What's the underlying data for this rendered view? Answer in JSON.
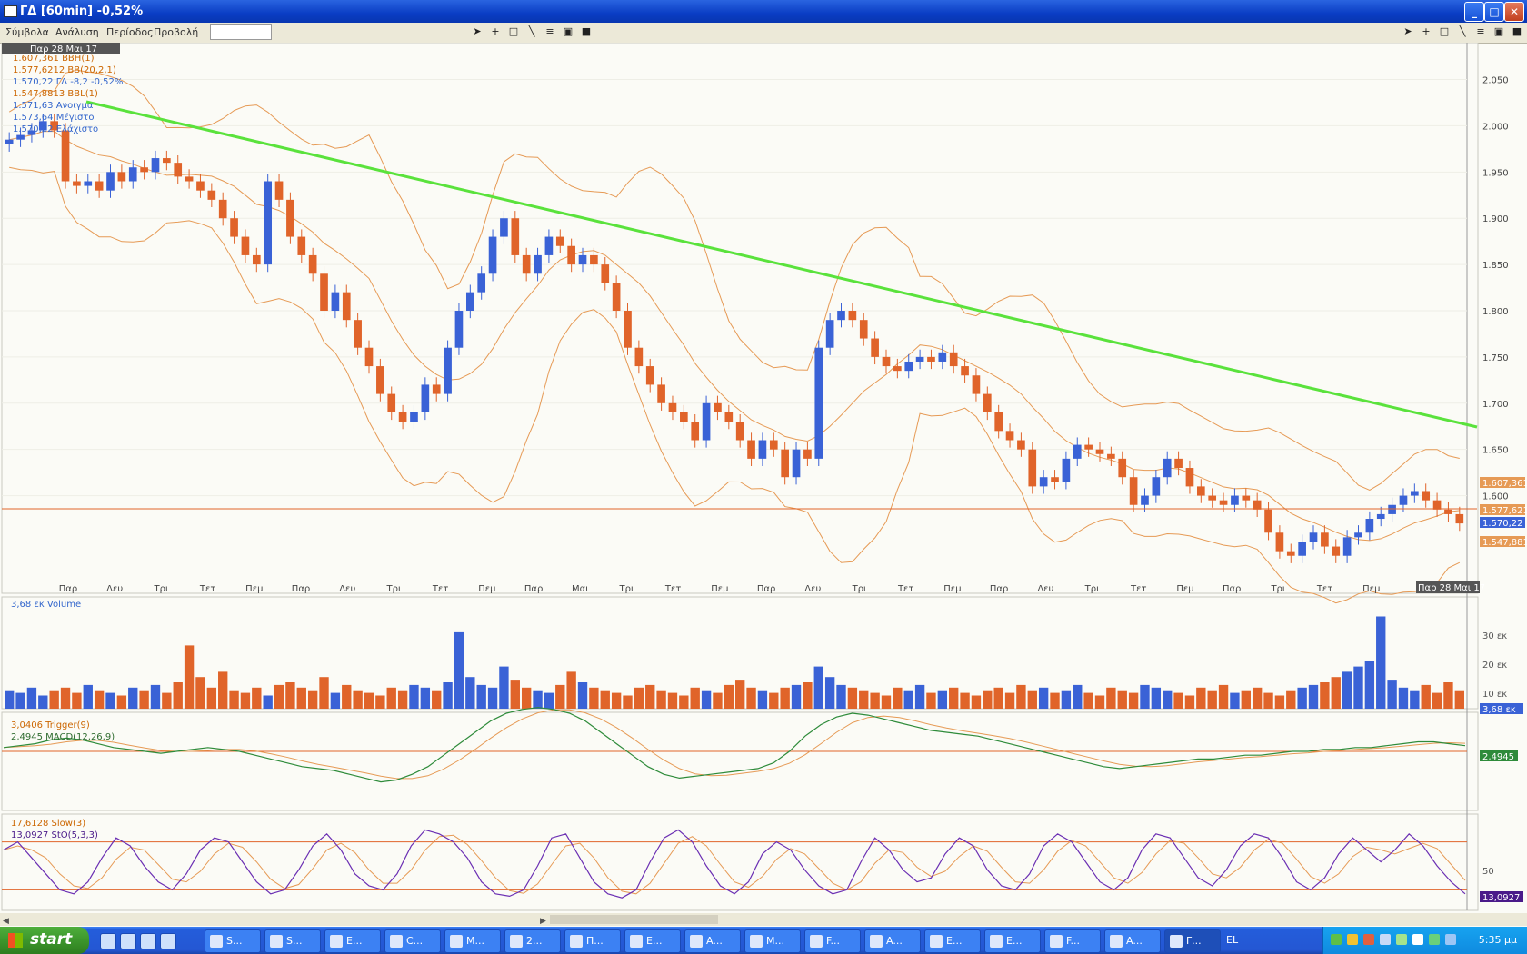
{
  "window": {
    "title": "ΓΔ [60min] -0,52%",
    "buttons": [
      "_",
      "□",
      "✕"
    ]
  },
  "menu": [
    "Σύμβολα",
    "Ανάλυση",
    "Περίοδος",
    "Προβολή"
  ],
  "price_panel": {
    "date_box": "Παρ 28 Μαι 17",
    "overlays": [
      {
        "text": "1.607,361 BBH(1)",
        "color": "#cc6600"
      },
      {
        "text": "1.577,6212 BB(20,2,1)",
        "color": "#cc6600"
      },
      {
        "text": "1.570,22 ΓΔ -8,2 -0,52%",
        "color": "#3366cc"
      },
      {
        "text": "1.547,8813 BBL(1)",
        "color": "#cc6600"
      },
      {
        "text": "1.571,63 Ανοιγμα",
        "color": "#3366cc"
      },
      {
        "text": "1.573,64 Μέγιστο",
        "color": "#3366cc"
      },
      {
        "text": "1.570,22 Ελάχιστο",
        "color": "#3366cc"
      }
    ],
    "y_ticks": [
      "2.050",
      "2.000",
      "1.950",
      "1.900",
      "1.850",
      "1.800",
      "1.750",
      "1.700",
      "1.650",
      "1.600"
    ],
    "right_tags": [
      "1.607,361",
      "1.577,621",
      "1.570,22",
      "1.547,881"
    ],
    "x_labels": [
      "Παρ",
      "Δευ",
      "Τρι",
      "Τετ",
      "Πεμ",
      "Παρ",
      "Δευ",
      "Τρι",
      "Τετ",
      "Πεμ",
      "Παρ",
      "Μαι",
      "Τρι",
      "Τετ",
      "Πεμ",
      "Παρ",
      "Δευ",
      "Τρι",
      "Τετ",
      "Πεμ",
      "Παρ",
      "Δευ",
      "Τρι",
      "Τετ",
      "Πεμ",
      "Παρ",
      "Τρι",
      "Τετ",
      "Πεμ"
    ],
    "x_last": "Παρ 28 Μαι 17"
  },
  "volume_panel": {
    "label": "3,68 εκ Volume",
    "y_ticks": [
      "30 εκ",
      "20 εκ",
      "10 εκ"
    ],
    "tag": "3,68 εκ"
  },
  "macd_panel": {
    "labels": [
      "3,0406 Trigger(9)",
      "2,4945 MACD(12,26,9)"
    ],
    "tag": "2,4945"
  },
  "stoch_panel": {
    "labels": [
      "17,6128 Slow(3)",
      "13,0927 StO(5,3,3)"
    ],
    "y_ticks": [
      "50"
    ],
    "tag": "13,0927"
  },
  "colors": {
    "up": "#3a62d6",
    "down": "#e0642a",
    "band": "#e69a55",
    "trend": "#5ae23c",
    "macd": "#2e8b3a",
    "trigger": "#e69a55",
    "stoch": "#6b2fb3",
    "slow": "#e69a55"
  },
  "chart_data": {
    "type": "candlestick",
    "y_range": [
      1520,
      2080
    ],
    "close_approx": [
      1985,
      1990,
      1995,
      2005,
      1995,
      1940,
      1935,
      1940,
      1930,
      1950,
      1940,
      1955,
      1950,
      1965,
      1960,
      1945,
      1940,
      1930,
      1920,
      1900,
      1880,
      1860,
      1850,
      1940,
      1920,
      1880,
      1860,
      1840,
      1800,
      1820,
      1790,
      1760,
      1740,
      1710,
      1690,
      1680,
      1690,
      1720,
      1710,
      1760,
      1800,
      1820,
      1840,
      1880,
      1900,
      1860,
      1840,
      1860,
      1880,
      1870,
      1850,
      1860,
      1850,
      1830,
      1800,
      1760,
      1740,
      1720,
      1700,
      1690,
      1680,
      1660,
      1700,
      1690,
      1680,
      1660,
      1640,
      1660,
      1650,
      1620,
      1650,
      1640,
      1760,
      1790,
      1800,
      1790,
      1770,
      1750,
      1740,
      1735,
      1745,
      1750,
      1745,
      1755,
      1740,
      1730,
      1710,
      1690,
      1670,
      1660,
      1650,
      1610,
      1620,
      1615,
      1640,
      1655,
      1650,
      1645,
      1640,
      1620,
      1590,
      1600,
      1620,
      1640,
      1630,
      1610,
      1600,
      1595,
      1590,
      1600,
      1595,
      1585,
      1560,
      1540,
      1535,
      1550,
      1560,
      1545,
      1535,
      1555,
      1560,
      1575,
      1580,
      1590,
      1600,
      1605,
      1595,
      1585,
      1580,
      1570
    ],
    "volume_approx": [
      7,
      6,
      8,
      5,
      7,
      8,
      6,
      9,
      7,
      6,
      5,
      8,
      7,
      9,
      6,
      10,
      24,
      12,
      8,
      14,
      7,
      6,
      8,
      5,
      9,
      10,
      8,
      7,
      12,
      6,
      9,
      7,
      6,
      5,
      8,
      7,
      9,
      8,
      7,
      10,
      29,
      12,
      9,
      8,
      16,
      11,
      8,
      7,
      6,
      9,
      14,
      10,
      8,
      7,
      6,
      5,
      8,
      9,
      7,
      6,
      5,
      8,
      7,
      6,
      9,
      11,
      8,
      7,
      6,
      8,
      9,
      10,
      16,
      12,
      9,
      8,
      7,
      6,
      5,
      8,
      7,
      9,
      6,
      7,
      8,
      6,
      5,
      7,
      8,
      6,
      9,
      7,
      8,
      6,
      7,
      9,
      6,
      5,
      8,
      7,
      6,
      9,
      8,
      7,
      6,
      5,
      8,
      7,
      9,
      6,
      7,
      8,
      6,
      5,
      7,
      8,
      9,
      10,
      12,
      14,
      16,
      18,
      35,
      11,
      8,
      7,
      9,
      6,
      10,
      7
    ],
    "macd_approx": [
      2,
      3,
      4,
      6,
      7,
      6,
      4,
      2,
      1,
      0,
      -1,
      0,
      1,
      2,
      1,
      0,
      -2,
      -4,
      -6,
      -8,
      -9,
      -10,
      -12,
      -14,
      -16,
      -15,
      -12,
      -8,
      -2,
      4,
      10,
      16,
      20,
      22,
      23,
      22,
      20,
      16,
      10,
      4,
      -2,
      -8,
      -12,
      -14,
      -13,
      -12,
      -11,
      -10,
      -9,
      -6,
      0,
      8,
      14,
      18,
      20,
      19,
      17,
      15,
      13,
      11,
      10,
      9,
      8,
      6,
      4,
      2,
      0,
      -2,
      -4,
      -6,
      -8,
      -9,
      -8,
      -7,
      -6,
      -5,
      -4,
      -4,
      -3,
      -2,
      -2,
      -1,
      0,
      0,
      1,
      1,
      2,
      2,
      3,
      4,
      5,
      5,
      4,
      3
    ],
    "stoch_approx": [
      70,
      80,
      60,
      40,
      20,
      15,
      30,
      60,
      85,
      75,
      50,
      30,
      20,
      40,
      70,
      85,
      80,
      55,
      30,
      15,
      20,
      45,
      75,
      90,
      70,
      40,
      25,
      20,
      40,
      75,
      95,
      90,
      80,
      60,
      30,
      15,
      12,
      20,
      50,
      85,
      90,
      60,
      30,
      15,
      10,
      20,
      55,
      85,
      95,
      80,
      50,
      25,
      15,
      30,
      65,
      80,
      70,
      45,
      25,
      15,
      20,
      55,
      85,
      70,
      45,
      30,
      35,
      65,
      85,
      75,
      45,
      25,
      20,
      40,
      75,
      90,
      80,
      55,
      30,
      20,
      35,
      70,
      90,
      85,
      60,
      35,
      25,
      45,
      75,
      90,
      85,
      60,
      30,
      20,
      35,
      65,
      85,
      70,
      55,
      70,
      90,
      75,
      50,
      30,
      15
    ]
  },
  "taskbar": {
    "start": "start",
    "tasks": [
      "S...",
      "S...",
      "E...",
      "C...",
      "M...",
      "2...",
      "П...",
      "E...",
      "A...",
      "M...",
      "F...",
      "A...",
      "E...",
      "E...",
      "F...",
      "A...",
      "Γ..."
    ],
    "lang": "EL",
    "clock": "5:35 μμ"
  }
}
